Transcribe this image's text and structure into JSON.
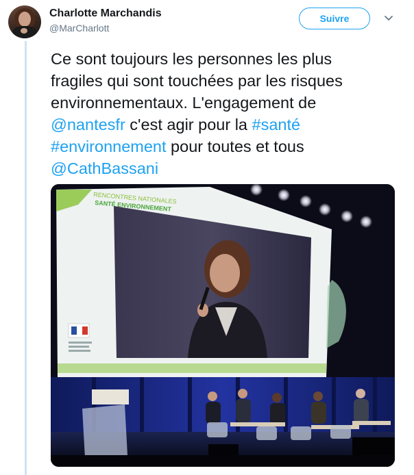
{
  "author": {
    "name": "Charlotte Marchandis",
    "handle": "@MarCharlott"
  },
  "follow_button": {
    "label": "Suivre"
  },
  "tweet": {
    "line1": "Ce sont toujours les personnes les plus",
    "line2": "fragiles qui sont touchées par les risques",
    "line3": "environnementaux. L'engagement de",
    "mention1": "@nantesfr",
    "line4_text": " c'est agir pour la ",
    "hashtag1": "#santé",
    "hashtag2": "#environnement",
    "line5_text": " pour toutes et tous",
    "mention2": "@CathBassani"
  },
  "photo": {
    "screen_line1": "RENCONTRES NATIONALES",
    "screen_line2": "SANTÉ ENVIRONNEMENT"
  },
  "icons": {
    "caret": "chevron-down-icon",
    "avatar": "profile-photo"
  },
  "colors": {
    "link": "#1da1f2",
    "text": "#14171a",
    "secondary": "#657786",
    "thread_line": "#cfe3f3"
  }
}
